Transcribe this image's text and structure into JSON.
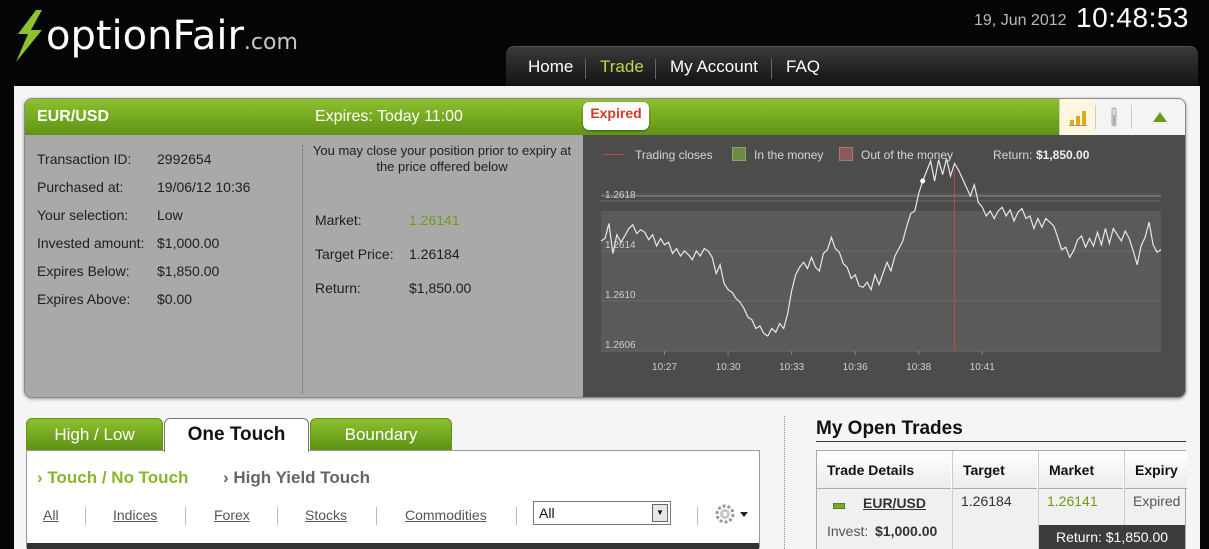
{
  "header": {
    "logo_main": "optionFair",
    "logo_suffix": ".com",
    "date": "19, Jun 2012",
    "time": "10:48:53"
  },
  "nav": {
    "items": [
      {
        "label": "Home",
        "active": false
      },
      {
        "label": "Trade",
        "active": true
      },
      {
        "label": "My Account",
        "active": false
      },
      {
        "label": "FAQ",
        "active": false
      }
    ]
  },
  "trade": {
    "pair": "EUR/USD",
    "expires": "Expires:  Today 11:00",
    "status_badge": "Expired",
    "icons": [
      "bar-chart-icon",
      "thermometer-icon",
      "collapse-arrow-icon"
    ],
    "details": [
      {
        "label": "Transaction ID:",
        "value": "2992654"
      },
      {
        "label": "Purchased at:",
        "value": "19/06/12 10:36"
      },
      {
        "label": "Your selection:",
        "value": "Low"
      },
      {
        "label": "Invested amount:",
        "value": "$1,000.00"
      },
      {
        "label": "Expires Below:",
        "value": "$1,850.00"
      },
      {
        "label": "Expires Above:",
        "value": "$0.00"
      }
    ],
    "close_note": "You may close your position prior to expiry at the price offered below",
    "market_label": "Market:",
    "market_value": "1.26141",
    "target_label": "Target Price:",
    "target_value": "1.26184",
    "return_label": "Return:",
    "return_value": "$1,850.00"
  },
  "chart_data": {
    "type": "line",
    "legend": [
      {
        "label": "Trading closes",
        "color": "#c24a3e"
      },
      {
        "label": "In the money",
        "color": "#6e8a45"
      },
      {
        "label": "Out of the money",
        "color": "#8a5a5a"
      }
    ],
    "return_label": "Return:",
    "return_value": "$1,850.00",
    "x_ticks": [
      "10:27",
      "10:30",
      "10:33",
      "10:36",
      "10:38",
      "10:41"
    ],
    "y_ticks": [
      "1.2606",
      "1.2610",
      "1.2614",
      "1.2618"
    ],
    "ylim": [
      1.2606,
      1.2618
    ],
    "target_level": 1.26184,
    "series": [
      {
        "values": [
          1.26148,
          1.2615,
          1.26162,
          1.26138,
          1.26153,
          1.26147,
          1.26152,
          1.26158,
          1.26161,
          1.26154,
          1.26157,
          1.26155,
          1.26149,
          1.26153,
          1.26144,
          1.2615,
          1.26145,
          1.26147,
          1.26138,
          1.26142,
          1.26136,
          1.2614,
          1.26137,
          1.26133,
          1.2614,
          1.26136,
          1.26142,
          1.2614,
          1.26135,
          1.26122,
          1.26129,
          1.26114,
          1.26109,
          1.26107,
          1.26102,
          1.26099,
          1.26094,
          1.26087,
          1.26085,
          1.26078,
          1.2608,
          1.26074,
          1.26072,
          1.26078,
          1.26075,
          1.26082,
          1.26078,
          1.2609,
          1.26108,
          1.26121,
          1.26127,
          1.26131,
          1.26126,
          1.26135,
          1.26127,
          1.26124,
          1.26138,
          1.26141,
          1.26151,
          1.26142,
          1.26139,
          1.2613,
          1.26127,
          1.26118,
          1.26121,
          1.26112,
          1.26111,
          1.26115,
          1.26109,
          1.26121,
          1.26113,
          1.26122,
          1.26131,
          1.26124,
          1.26136,
          1.26142,
          1.26148,
          1.2616,
          1.2617,
          1.26172,
          1.26186,
          1.26196,
          1.26204,
          1.26212,
          1.26196,
          1.26213,
          1.26201,
          1.26214,
          1.262,
          1.2621,
          1.26205,
          1.26198,
          1.26191,
          1.26184,
          1.26193,
          1.26179,
          1.26175,
          1.26168,
          1.26172,
          1.26166,
          1.26172,
          1.26175,
          1.26168,
          1.26173,
          1.26164,
          1.26171,
          1.26174,
          1.26166,
          1.26168,
          1.26158,
          1.26166,
          1.26159,
          1.26166,
          1.26163,
          1.2616,
          1.26151,
          1.26141,
          1.26143,
          1.26135,
          1.2614,
          1.26149,
          1.26152,
          1.26143,
          1.2615,
          1.26144,
          1.26155,
          1.26145,
          1.26158,
          1.26146,
          1.26158,
          1.26153,
          1.26148,
          1.26156,
          1.2615,
          1.2614,
          1.26129,
          1.26144,
          1.26151,
          1.26163,
          1.26145,
          1.26139,
          1.26141
        ]
      }
    ],
    "purchase_marker_value": 1.26184,
    "close_marker_x": "10:38"
  },
  "tabs": {
    "items": [
      {
        "label": "High / Low",
        "active": false
      },
      {
        "label": "One Touch",
        "active": true
      },
      {
        "label": "Boundary",
        "active": false
      }
    ],
    "subtabs": [
      {
        "label": "Touch / No Touch",
        "active": true
      },
      {
        "label": "High Yield Touch",
        "active": false
      }
    ],
    "filters": [
      "All",
      "Indices",
      "Forex",
      "Stocks",
      "Commodities"
    ],
    "select_value": "All"
  },
  "open_trades": {
    "title": "My Open Trades",
    "columns": [
      "Trade Details",
      "Target",
      "Market",
      "Expiry"
    ],
    "row": {
      "pair": "EUR/USD",
      "invest_label": "Invest:",
      "invest_value": "$1,000.00",
      "target": "1.26184",
      "market": "1.26141",
      "expiry": "Expired",
      "return": "Return: $1,850.00"
    }
  }
}
